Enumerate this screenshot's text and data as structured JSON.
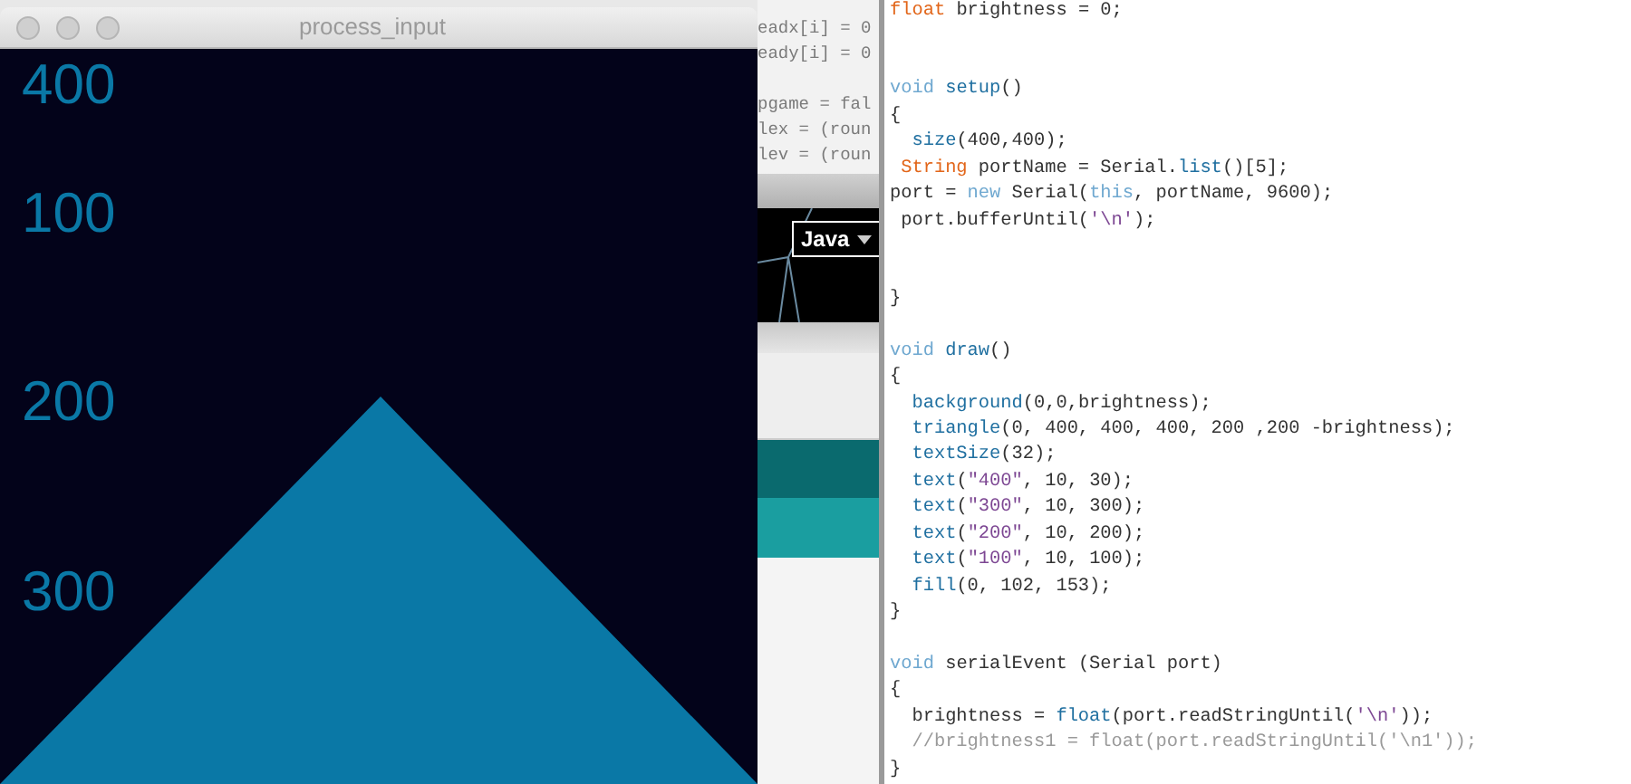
{
  "sketch_window": {
    "title": "process_input",
    "labels": [
      "400",
      "100",
      "200",
      "300"
    ]
  },
  "background_editor": {
    "code_lines": [
      "eadx[i] = 0",
      "eady[i] = 0",
      "pgame = fal",
      "lex = (roun",
      "lev = (roun"
    ],
    "mode_button": "Java"
  },
  "editor": {
    "lines": [
      {
        "kind": "code",
        "segments": [
          {
            "kind": "type",
            "text": "float"
          },
          {
            "kind": "plain",
            "text": " brightness = 0;"
          }
        ]
      },
      {
        "kind": "blank"
      },
      {
        "kind": "blank"
      },
      {
        "kind": "code",
        "segments": [
          {
            "kind": "keyword",
            "text": "void"
          },
          {
            "kind": "function",
            "text": " setup"
          },
          {
            "kind": "plain",
            "text": "()"
          }
        ]
      },
      {
        "kind": "code",
        "segments": [
          {
            "kind": "plain",
            "text": "{"
          }
        ]
      },
      {
        "kind": "code",
        "segments": [
          {
            "kind": "function",
            "text": "  size"
          },
          {
            "kind": "plain",
            "text": "(400,400);"
          }
        ]
      },
      {
        "kind": "code",
        "segments": [
          {
            "kind": "type",
            "text": " String"
          },
          {
            "kind": "plain",
            "text": " portName = Serial."
          },
          {
            "kind": "function",
            "text": "list"
          },
          {
            "kind": "plain",
            "text": "()[5];"
          }
        ]
      },
      {
        "kind": "code",
        "segments": [
          {
            "kind": "plain",
            "text": "port = "
          },
          {
            "kind": "keyword",
            "text": "new"
          },
          {
            "kind": "plain",
            "text": " Serial("
          },
          {
            "kind": "keyword",
            "text": "this"
          },
          {
            "kind": "plain",
            "text": ", portName, 9600);"
          }
        ]
      },
      {
        "kind": "code",
        "segments": [
          {
            "kind": "plain",
            "text": " port.bufferUntil("
          },
          {
            "kind": "string",
            "text": "'\\n'"
          },
          {
            "kind": "plain",
            "text": ");"
          }
        ]
      },
      {
        "kind": "blank"
      },
      {
        "kind": "blank"
      },
      {
        "kind": "code",
        "segments": [
          {
            "kind": "plain",
            "text": "}"
          }
        ]
      },
      {
        "kind": "blank"
      },
      {
        "kind": "code",
        "segments": [
          {
            "kind": "keyword",
            "text": "void"
          },
          {
            "kind": "function",
            "text": " draw"
          },
          {
            "kind": "plain",
            "text": "()"
          }
        ]
      },
      {
        "kind": "code",
        "segments": [
          {
            "kind": "plain",
            "text": "{"
          }
        ]
      },
      {
        "kind": "code",
        "segments": [
          {
            "kind": "function",
            "text": "  background"
          },
          {
            "kind": "plain",
            "text": "(0,0,brightness);"
          }
        ]
      },
      {
        "kind": "code",
        "segments": [
          {
            "kind": "function",
            "text": "  triangle"
          },
          {
            "kind": "plain",
            "text": "(0, 400, 400, 400, 200 ,200 -brightness);"
          }
        ]
      },
      {
        "kind": "code",
        "segments": [
          {
            "kind": "function",
            "text": "  textSize"
          },
          {
            "kind": "plain",
            "text": "(32);"
          }
        ]
      },
      {
        "kind": "code",
        "segments": [
          {
            "kind": "function",
            "text": "  text"
          },
          {
            "kind": "plain",
            "text": "("
          },
          {
            "kind": "string",
            "text": "\"400\""
          },
          {
            "kind": "plain",
            "text": ", 10, 30);"
          }
        ]
      },
      {
        "kind": "code",
        "segments": [
          {
            "kind": "function",
            "text": "  text"
          },
          {
            "kind": "plain",
            "text": "("
          },
          {
            "kind": "string",
            "text": "\"300\""
          },
          {
            "kind": "plain",
            "text": ", 10, 300);"
          }
        ]
      },
      {
        "kind": "code",
        "segments": [
          {
            "kind": "function",
            "text": "  text"
          },
          {
            "kind": "plain",
            "text": "("
          },
          {
            "kind": "string",
            "text": "\"200\""
          },
          {
            "kind": "plain",
            "text": ", 10, 200);"
          }
        ]
      },
      {
        "kind": "code",
        "segments": [
          {
            "kind": "function",
            "text": "  text"
          },
          {
            "kind": "plain",
            "text": "("
          },
          {
            "kind": "string",
            "text": "\"100\""
          },
          {
            "kind": "plain",
            "text": ", 10, 100);"
          }
        ]
      },
      {
        "kind": "code",
        "segments": [
          {
            "kind": "function",
            "text": "  fill"
          },
          {
            "kind": "plain",
            "text": "(0, 102, 153);"
          }
        ]
      },
      {
        "kind": "code",
        "segments": [
          {
            "kind": "plain",
            "text": "}"
          }
        ]
      },
      {
        "kind": "blank"
      },
      {
        "kind": "code",
        "segments": [
          {
            "kind": "keyword",
            "text": "void"
          },
          {
            "kind": "plain",
            "text": " serialEvent (Serial port)"
          }
        ]
      },
      {
        "kind": "code",
        "segments": [
          {
            "kind": "plain",
            "text": "{"
          }
        ]
      },
      {
        "kind": "code",
        "segments": [
          {
            "kind": "plain",
            "text": "  brightness = "
          },
          {
            "kind": "function",
            "text": "float"
          },
          {
            "kind": "plain",
            "text": "(port.readStringUntil("
          },
          {
            "kind": "string",
            "text": "'\\n'"
          },
          {
            "kind": "plain",
            "text": "));"
          }
        ]
      },
      {
        "kind": "code",
        "segments": [
          {
            "kind": "comment",
            "text": "  //brightness1 = float(port.readStringUntil('\\n1'));"
          }
        ]
      },
      {
        "kind": "code",
        "segments": [
          {
            "kind": "plain",
            "text": "}"
          }
        ]
      }
    ]
  }
}
